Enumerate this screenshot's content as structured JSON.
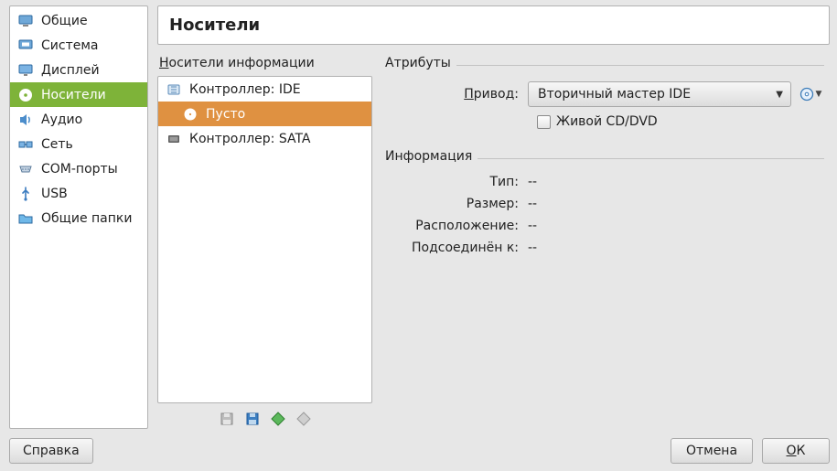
{
  "sidebar": {
    "items": [
      {
        "id": "general",
        "label": "Общие",
        "icon": "monitor",
        "selected": false
      },
      {
        "id": "system",
        "label": "Система",
        "icon": "chip",
        "selected": false
      },
      {
        "id": "display",
        "label": "Дисплей",
        "icon": "display",
        "selected": false
      },
      {
        "id": "storage",
        "label": "Носители",
        "icon": "disc",
        "selected": true
      },
      {
        "id": "audio",
        "label": "Аудио",
        "icon": "speaker",
        "selected": false
      },
      {
        "id": "network",
        "label": "Сеть",
        "icon": "network",
        "selected": false
      },
      {
        "id": "serial",
        "label": "COM-порты",
        "icon": "serial",
        "selected": false
      },
      {
        "id": "usb",
        "label": "USB",
        "icon": "usb",
        "selected": false
      },
      {
        "id": "shared",
        "label": "Общие папки",
        "icon": "folder",
        "selected": false
      }
    ]
  },
  "title": "Носители",
  "tree": {
    "label_html": "<span class='accel'>Н</span>осители информации",
    "rows": [
      {
        "icon": "ide",
        "label": "Контроллер: IDE",
        "indent": 0,
        "selected": false
      },
      {
        "icon": "cd",
        "label": "Пусто",
        "indent": 1,
        "selected": true
      },
      {
        "icon": "sata",
        "label": "Контроллер: SATA",
        "indent": 0,
        "selected": false
      }
    ],
    "toolbar": [
      {
        "id": "add-controller-disabled",
        "icon": "floppy-gray"
      },
      {
        "id": "add-controller",
        "icon": "floppy-blue"
      },
      {
        "id": "add-attachment",
        "icon": "diamond-green"
      },
      {
        "id": "remove-attachment",
        "icon": "diamond-gray"
      }
    ]
  },
  "attributes": {
    "legend": "Атрибуты",
    "drive_label_html": "<span class='accel'>П</span>ривод:",
    "drive_value": "Вторичный мастер IDE",
    "live_cd_label": "Живой CD/DVD",
    "live_cd_checked": false
  },
  "info": {
    "legend": "Информация",
    "rows": [
      {
        "label": "Тип:",
        "value": "--"
      },
      {
        "label": "Размер:",
        "value": "--"
      },
      {
        "label": "Расположение:",
        "value": "--"
      },
      {
        "label": "Подсоединён к:",
        "value": "--"
      }
    ]
  },
  "buttons": {
    "help": "Справка",
    "cancel": "Отмена",
    "ok_html": "<span class='accel'>О</span>К"
  }
}
